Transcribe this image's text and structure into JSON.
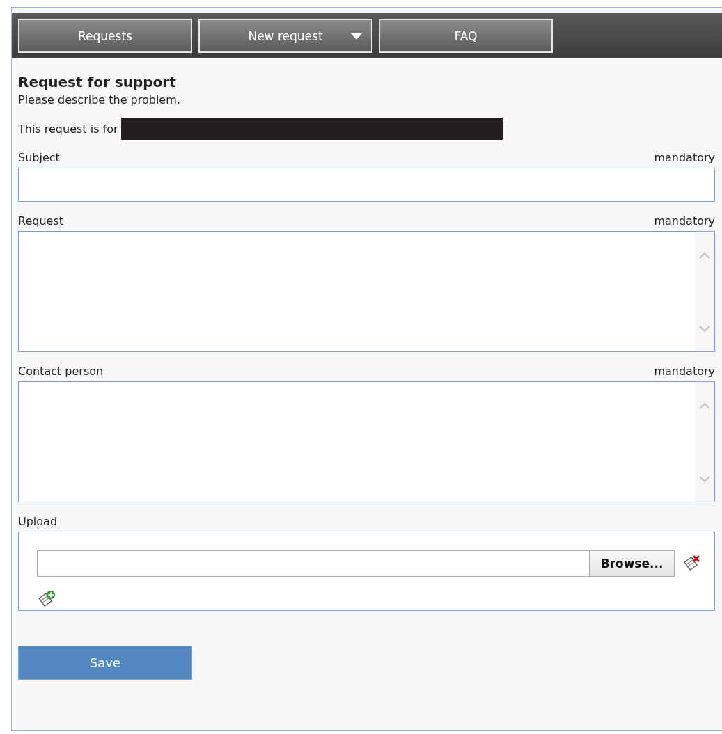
{
  "menu": [
    {
      "label": "Requests",
      "dropdown": false
    },
    {
      "label": "New request",
      "dropdown": true
    },
    {
      "label": "FAQ",
      "dropdown": false
    }
  ],
  "form": {
    "title": "Request for support",
    "subtitle": "Please describe the problem.",
    "request_for": {
      "label": "This request is for",
      "redacted": true
    },
    "fields": [
      {
        "label": "Subject",
        "kind": "text",
        "mandatory": "mandatory"
      },
      {
        "label": "Request",
        "kind": "textarea",
        "mandatory": "mandatory"
      },
      {
        "label": "Contact person",
        "kind": "textarea",
        "mandatory": "mandatory"
      }
    ],
    "upload": {
      "label": "Upload",
      "browse_button": "Browse..."
    },
    "save_button": "Save"
  }
}
